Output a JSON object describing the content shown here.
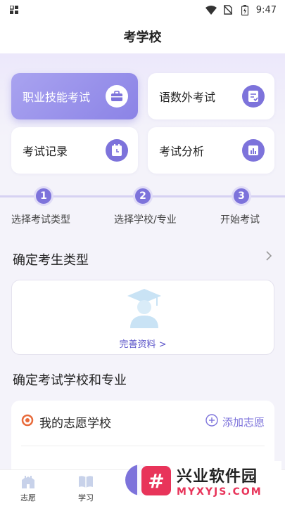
{
  "statusbar": {
    "time": "9:47"
  },
  "header": {
    "title": "考学校"
  },
  "cards": [
    {
      "label": "职业技能考试",
      "icon": "briefcase-icon",
      "active": true
    },
    {
      "label": "语数外考试",
      "icon": "exam-sheet-icon",
      "active": false
    },
    {
      "label": "考试记录",
      "icon": "calendar-clock-icon",
      "active": false
    },
    {
      "label": "考试分析",
      "icon": "bar-chart-icon",
      "active": false
    }
  ],
  "steps": [
    {
      "num": "1",
      "label": "选择考试类型"
    },
    {
      "num": "2",
      "label": "选择学校/专业"
    },
    {
      "num": "3",
      "label": "开始考试"
    }
  ],
  "section1": {
    "title": "确定考生类型",
    "link": "完善资料 >"
  },
  "section2": {
    "title": "确定考试学校和专业",
    "row_label": "我的志愿学校",
    "add_label": "添加志愿"
  },
  "tabbar": {
    "tabs": [
      {
        "label": "志愿"
      },
      {
        "label": "学习"
      }
    ]
  },
  "watermark": {
    "title": "兴业软件园",
    "sub": "MYXYJS.COM"
  },
  "colors": {
    "accent": "#7d73db",
    "active_card": "#9a92ec",
    "brand_red": "#e8345a"
  }
}
